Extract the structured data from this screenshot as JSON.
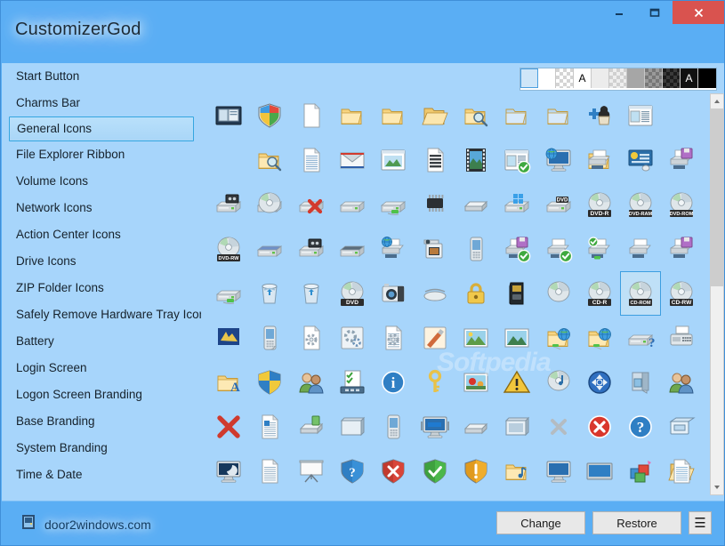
{
  "window": {
    "title": "CustomizerGod",
    "controls": [
      {
        "name": "minimize",
        "glyph": "–"
      },
      {
        "name": "maximize",
        "glyph": "❐"
      },
      {
        "name": "close",
        "glyph": "✕"
      }
    ],
    "accent_color": "#5aaef4",
    "close_color": "#d9534f",
    "selection_color": "#35a6e0"
  },
  "sidebar": {
    "selected": "General Icons",
    "items": [
      {
        "label": "Start Button"
      },
      {
        "label": "Charms Bar"
      },
      {
        "label": "General Icons"
      },
      {
        "label": "File Explorer Ribbon"
      },
      {
        "label": "Volume Icons"
      },
      {
        "label": "Network Icons"
      },
      {
        "label": "Action Center Icons"
      },
      {
        "label": "Drive Icons"
      },
      {
        "label": "ZIP Folder Icons"
      },
      {
        "label": "Safely Remove Hardware Tray Icon"
      },
      {
        "label": "Battery"
      },
      {
        "label": "Login Screen"
      },
      {
        "label": "Logon Screen Branding"
      },
      {
        "label": "Base Branding"
      },
      {
        "label": "System Branding"
      },
      {
        "label": "Time & Date"
      }
    ]
  },
  "background_swatches": [
    {
      "name": "swatch-light-blue",
      "kind": "solid",
      "color": "#cfe6f8",
      "selected": true,
      "letter": ""
    },
    {
      "name": "swatch-white",
      "kind": "solid",
      "color": "#ffffff",
      "selected": false,
      "letter": ""
    },
    {
      "name": "swatch-white-checker",
      "kind": "checker",
      "color": "#ffffff",
      "alt": "#d4d4d4",
      "selected": false,
      "letter": ""
    },
    {
      "name": "swatch-white-letter",
      "kind": "solid",
      "color": "#ffffff",
      "selected": false,
      "letter": "A"
    },
    {
      "name": "swatch-light-gray",
      "kind": "solid",
      "color": "#ececec",
      "selected": false,
      "letter": ""
    },
    {
      "name": "swatch-light-gray-checker",
      "kind": "checker",
      "color": "#eeeeee",
      "alt": "#d0d0d0",
      "selected": false,
      "letter": ""
    },
    {
      "name": "swatch-gray",
      "kind": "solid",
      "color": "#a6a6a6",
      "selected": false,
      "letter": ""
    },
    {
      "name": "swatch-gray-checker",
      "kind": "checker",
      "color": "#9a9a9a",
      "alt": "#777777",
      "selected": false,
      "letter": ""
    },
    {
      "name": "swatch-dark-checker",
      "kind": "checker",
      "color": "#3a3a3a",
      "alt": "#1c1c1c",
      "selected": false,
      "letter": ""
    },
    {
      "name": "swatch-black-letter",
      "kind": "solid",
      "color": "#111111",
      "selected": false,
      "letter": "A"
    },
    {
      "name": "swatch-black",
      "kind": "solid",
      "color": "#000000",
      "selected": false,
      "letter": ""
    }
  ],
  "icon_grid": {
    "columns": 12,
    "selected_index": 58,
    "icons": [
      {
        "name": "display-properties-icon"
      },
      {
        "name": "windows-shield-icon"
      },
      {
        "name": "blank-document-icon"
      },
      {
        "name": "folder-icon"
      },
      {
        "name": "folder-icon"
      },
      {
        "name": "folder-open-icon"
      },
      {
        "name": "folder-search-icon"
      },
      {
        "name": "folder-page-icon"
      },
      {
        "name": "folder-small-icon"
      },
      {
        "name": "games-chess-icon"
      },
      {
        "name": "window-properties-icon"
      },
      {
        "name": "blank-cell"
      },
      {
        "name": "blank-cell"
      },
      {
        "name": "folder-search-icon"
      },
      {
        "name": "text-document-icon"
      },
      {
        "name": "mail-envelope-icon"
      },
      {
        "name": "image-viewer-icon"
      },
      {
        "name": "sheet-music-icon"
      },
      {
        "name": "film-strip-icon"
      },
      {
        "name": "window-check-icon"
      },
      {
        "name": "network-computer-icon"
      },
      {
        "name": "printer-folder-icon"
      },
      {
        "name": "control-panel-icon"
      },
      {
        "name": "floppy-drive-icon"
      },
      {
        "name": "tape-drive-icon"
      },
      {
        "name": "cd-drive-icon"
      },
      {
        "name": "drive-error-icon"
      },
      {
        "name": "hard-drive-icon"
      },
      {
        "name": "drive-network-icon"
      },
      {
        "name": "memory-chip-icon"
      },
      {
        "name": "scanner-icon"
      },
      {
        "name": "windows-drive-icon"
      },
      {
        "name": "dvd-drive-icon"
      },
      {
        "name": "dvd-r-disc-icon",
        "label": "DVD-R"
      },
      {
        "name": "dvd-ram-disc-icon",
        "label": "DVD-RAM"
      },
      {
        "name": "dvd-rom-disc-icon",
        "label": "DVD-ROM"
      },
      {
        "name": "dvd-rw-disc-icon",
        "label": "DVD-RW"
      },
      {
        "name": "blue-drive-icon"
      },
      {
        "name": "tape-cassette-drive-icon"
      },
      {
        "name": "dark-drive-icon"
      },
      {
        "name": "network-printer-icon"
      },
      {
        "name": "camcorder-icon"
      },
      {
        "name": "mobile-phone-icon"
      },
      {
        "name": "printer-floppy-check-icon"
      },
      {
        "name": "printer-check-icon"
      },
      {
        "name": "printer-network-check-icon"
      },
      {
        "name": "printer-icon"
      },
      {
        "name": "printer-floppy-icon"
      },
      {
        "name": "drive-network-green-icon"
      },
      {
        "name": "recycle-bin-full-icon"
      },
      {
        "name": "recycle-bin-empty-icon"
      },
      {
        "name": "dvd-disc-icon",
        "label": "DVD"
      },
      {
        "name": "camera-icon"
      },
      {
        "name": "optical-drive-flat-icon"
      },
      {
        "name": "padlock-icon"
      },
      {
        "name": "memory-card-icon"
      },
      {
        "name": "cd-disc-icon"
      },
      {
        "name": "cd-r-disc-icon",
        "label": "CD-R"
      },
      {
        "name": "cd-rom-disc-icon",
        "label": "CD-ROM"
      },
      {
        "name": "cd-rw-disc-icon",
        "label": "CD-RW"
      },
      {
        "name": "display-blue-icon"
      },
      {
        "name": "media-player-device-icon"
      },
      {
        "name": "settings-file-icon"
      },
      {
        "name": "settings-panel-icon"
      },
      {
        "name": "settings-document-icon"
      },
      {
        "name": "paint-brush-icon"
      },
      {
        "name": "picture-thumbnail-icon"
      },
      {
        "name": "photo-frame-icon"
      },
      {
        "name": "folder-web-icon"
      },
      {
        "name": "folder-web-open-icon"
      },
      {
        "name": "drive-unknown-icon"
      },
      {
        "name": "fax-machine-icon"
      },
      {
        "name": "fonts-folder-icon"
      },
      {
        "name": "security-shield-icon"
      },
      {
        "name": "users-group-icon"
      },
      {
        "name": "task-checklist-icon"
      },
      {
        "name": "info-bubble-icon"
      },
      {
        "name": "key-icon"
      },
      {
        "name": "flowers-picture-icon"
      },
      {
        "name": "warning-triangle-icon"
      },
      {
        "name": "audio-cd-icon"
      },
      {
        "name": "sync-center-icon"
      },
      {
        "name": "help-book-icon"
      },
      {
        "name": "users-pair-icon"
      },
      {
        "name": "delete-cross-icon"
      },
      {
        "name": "rich-document-icon"
      },
      {
        "name": "scanner-flatbed-icon"
      },
      {
        "name": "banner-icon"
      },
      {
        "name": "pda-device-icon"
      },
      {
        "name": "remote-display-icon"
      },
      {
        "name": "scanner-thin-icon"
      },
      {
        "name": "briefcase-icon"
      },
      {
        "name": "close-gray-icon"
      },
      {
        "name": "error-circle-icon"
      },
      {
        "name": "help-circle-icon"
      },
      {
        "name": "window-stack-icon"
      },
      {
        "name": "monitor-sleep-icon"
      },
      {
        "name": "notepad-icon"
      },
      {
        "name": "presentation-screen-icon"
      },
      {
        "name": "shield-help-icon"
      },
      {
        "name": "shield-error-icon"
      },
      {
        "name": "shield-ok-icon"
      },
      {
        "name": "shield-warning-icon"
      },
      {
        "name": "music-folder-icon"
      },
      {
        "name": "computer-blue-icon"
      },
      {
        "name": "screen-blue-icon"
      },
      {
        "name": "packages-icon"
      },
      {
        "name": "folder-document-icon"
      }
    ]
  },
  "watermark": {
    "text": "Softpedia"
  },
  "footer": {
    "brand": "door2windows.com",
    "change_label": "Change",
    "restore_label": "Restore",
    "menu_label": "☰"
  }
}
